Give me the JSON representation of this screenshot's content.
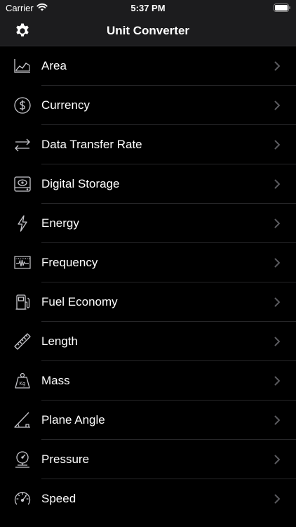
{
  "status": {
    "carrier": "Carrier",
    "time": "5:37 PM"
  },
  "nav": {
    "title": "Unit Converter"
  },
  "items": [
    {
      "label": "Area",
      "icon": "area-chart-icon"
    },
    {
      "label": "Currency",
      "icon": "dollar-circle-icon"
    },
    {
      "label": "Data Transfer Rate",
      "icon": "transfer-arrows-icon"
    },
    {
      "label": "Digital Storage",
      "icon": "hard-drive-icon"
    },
    {
      "label": "Energy",
      "icon": "lightning-icon"
    },
    {
      "label": "Frequency",
      "icon": "waveform-icon"
    },
    {
      "label": "Fuel Economy",
      "icon": "fuel-pump-icon"
    },
    {
      "label": "Length",
      "icon": "ruler-icon"
    },
    {
      "label": "Mass",
      "icon": "kg-weight-icon"
    },
    {
      "label": "Plane Angle",
      "icon": "angle-icon"
    },
    {
      "label": "Pressure",
      "icon": "pressure-gauge-icon"
    },
    {
      "label": "Speed",
      "icon": "speedometer-icon"
    }
  ],
  "colors": {
    "background": "#000000",
    "bar": "#1c1c1e",
    "icon": "#c7c7cc",
    "chevron": "#5a5a5e",
    "separator": "#262628"
  }
}
